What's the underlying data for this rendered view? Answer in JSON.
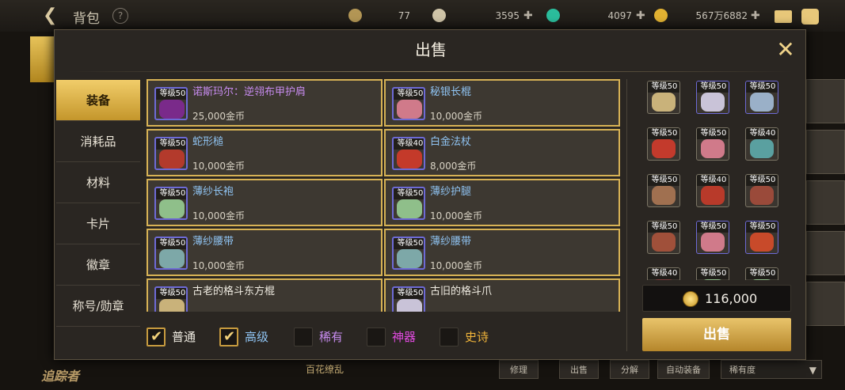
{
  "header": {
    "title": "背包",
    "currencies": [
      {
        "icon": "gold-coin-icon",
        "value": "77"
      },
      {
        "icon": "crystal-icon",
        "value": "3595"
      },
      {
        "icon": "gem-icon",
        "value": "4097"
      },
      {
        "icon": "coin-icon",
        "value": "567万6882"
      }
    ]
  },
  "modal": {
    "title": "出售",
    "tabs": [
      {
        "label": "装备",
        "active": true
      },
      {
        "label": "消耗品"
      },
      {
        "label": "材料"
      },
      {
        "label": "卡片"
      },
      {
        "label": "徽章"
      },
      {
        "label": "称号/勋章"
      }
    ],
    "items": [
      {
        "level": "等级50",
        "name": "诺斯玛尔：逆翎布甲护肩",
        "price": "25,000金币",
        "name_color": "#c88cf0",
        "art": "#7a2a8a",
        "selected": true
      },
      {
        "level": "等级50",
        "name": "秘银长棍",
        "price": "10,000金币",
        "name_color": "#8fc3f2",
        "art": "#d07a8a",
        "selected": true
      },
      {
        "level": "等级50",
        "name": "蛇形槌",
        "price": "10,000金币",
        "name_color": "#8fc3f2",
        "art": "#b33a2c",
        "selected": true
      },
      {
        "level": "等级40",
        "name": "白金法杖",
        "price": "8,000金币",
        "name_color": "#8fc3f2",
        "art": "#c43a2a",
        "selected": true
      },
      {
        "level": "等级50",
        "name": "薄纱长袍",
        "price": "10,000金币",
        "name_color": "#8fc3f2",
        "art": "#8fbf8a",
        "selected": true
      },
      {
        "level": "等级50",
        "name": "薄纱护腿",
        "price": "10,000金币",
        "name_color": "#8fc3f2",
        "art": "#8fbf8a",
        "selected": true
      },
      {
        "level": "等级50",
        "name": "薄纱腰带",
        "price": "10,000金币",
        "name_color": "#8fc3f2",
        "art": "#7da8a8",
        "selected": true
      },
      {
        "level": "等级50",
        "name": "薄纱腰带",
        "price": "10,000金币",
        "name_color": "#8fc3f2",
        "art": "#7da8a8",
        "selected": true
      },
      {
        "level": "等级50",
        "name": "古老的格斗东方棍",
        "price": "",
        "name_color": "#f0ece2",
        "art": "#c9b27a",
        "selected": true
      },
      {
        "level": "等级50",
        "name": "古旧的格斗爪",
        "price": "",
        "name_color": "#f0ece2",
        "art": "#c9c3d8",
        "selected": true
      }
    ],
    "filters": [
      {
        "label": "普通",
        "checked": true,
        "color": "#f0ece2"
      },
      {
        "label": "高级",
        "checked": true,
        "color": "#8fc3f2"
      },
      {
        "label": "稀有",
        "checked": false,
        "color": "#c88cf0"
      },
      {
        "label": "神器",
        "checked": false,
        "color": "#e04adf"
      },
      {
        "label": "史诗",
        "checked": false,
        "color": "#f0b43a"
      }
    ],
    "selected_items": [
      {
        "level": "等级50",
        "art": "#c9b27a"
      },
      {
        "level": "等级50",
        "art": "#c9c3d8"
      },
      {
        "level": "等级50",
        "art": "#9ab0c8"
      },
      {
        "level": "等级50",
        "art": "#c33a2c"
      },
      {
        "level": "等级50",
        "art": "#d07a8a"
      },
      {
        "level": "等级40",
        "art": "#5aa0a0"
      },
      {
        "level": "等级50",
        "art": "#a07050"
      },
      {
        "level": "等级40",
        "art": "#b83a2a"
      },
      {
        "level": "等级50",
        "art": "#9a4a3a"
      },
      {
        "level": "等级50",
        "art": "#a0503a"
      },
      {
        "level": "等级50",
        "art": "#d07a8a"
      },
      {
        "level": "等级50",
        "art": "#c84a2a"
      },
      {
        "level": "等级40",
        "art": "#7a3a3a"
      },
      {
        "level": "等级50",
        "art": "#8fbf8a"
      },
      {
        "level": "等级50",
        "art": "#8fbf8a"
      }
    ],
    "total": "116,000",
    "sell_label": "出售"
  },
  "bottom": {
    "logo": "追踪者",
    "center_text": "百花缭乱",
    "buttons": [
      "修理",
      "出售",
      "分解",
      "自动装备"
    ],
    "sort_label": "稀有度"
  }
}
